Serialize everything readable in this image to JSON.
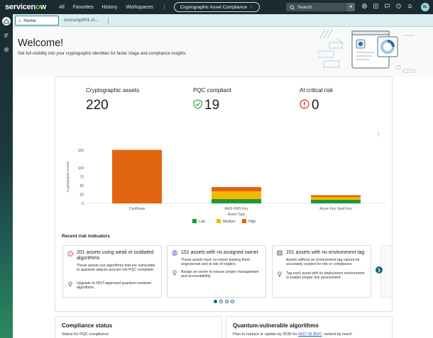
{
  "header": {
    "logo": "servicenow",
    "nav": [
      "All",
      "Favorites",
      "History",
      "Workspaces"
    ],
    "more_symbol": "⋮",
    "app_pill": "Cryptographic Asset Compliance",
    "search_label": "Search",
    "avatar_initials": "SL",
    "icons": [
      "globe-icon",
      "sparkle-icon",
      "chat-icon",
      "help-icon",
      "bell-icon"
    ]
  },
  "tabs": {
    "home": "Home",
    "second": "crucsvsph01.cr..."
  },
  "welcome": {
    "title": "Welcome!",
    "subtitle": "Get full visibility into your cryptographic identities for faster triage and compliance insights"
  },
  "metrics": {
    "assets_label": "Cryptographic assets",
    "assets_value": "220",
    "pqc_label": "PQC compliant",
    "pqc_value": "19",
    "critical_label": "At critical risk",
    "critical_value": "0"
  },
  "chart_data": {
    "type": "bar",
    "stacked": true,
    "categories": [
      "Certificate",
      "AWS KMS Key",
      "Azure Key Vault Key"
    ],
    "series": [
      {
        "name": "Low",
        "values": [
          0,
          12,
          10
        ],
        "color": "#1a9a3a"
      },
      {
        "name": "Medium",
        "values": [
          0,
          22,
          8
        ],
        "color": "#f5b800"
      },
      {
        "name": "High",
        "values": [
          151,
          12,
          5
        ],
        "color": "#e1650e"
      }
    ],
    "xlabel": "Asset Type",
    "ylabel": "Cryptographic Assets",
    "ylim": [
      0,
      150
    ],
    "yticks": [
      0,
      25,
      50,
      75,
      100,
      150
    ],
    "grid": false,
    "legend_position": "bottom"
  },
  "recent": {
    "title": "Recent risk indicators",
    "cards": [
      {
        "title": "201 assets using weak or outdated algorithms",
        "desc": "These assets use algorithms that are vulnerable to quantum attacks and are not PQC compliant.",
        "action": "Upgrade to NIST-approved quantum-resistant algorithms.",
        "icon": "alert-icon"
      },
      {
        "title": "151 assets with no assigned owner",
        "desc": "These assets have no owner leaving them ungoverned and at risk of neglect.",
        "action": "Assign an owner to ensure proper management and accountability.",
        "icon": "user-icon"
      },
      {
        "title": "151 assets with no environment tag",
        "desc": "Assets without an environment tag cannot be accurately scoped for risk or compliance.",
        "action": "Tag each asset with its deployment environment to enable proper risk assessment.",
        "icon": "server-icon"
      }
    ]
  },
  "bottom": {
    "compliance_title": "Compliance status",
    "compliance_sub": "Status for PQC compliance",
    "quantum_title": "Quantum-vulnerable algorithms",
    "quantum_sub_pre": "Plan to replace or update by 2035 for",
    "quantum_link": "NIST IR 8547",
    "quantum_sub_post": ", ranked by reach"
  }
}
